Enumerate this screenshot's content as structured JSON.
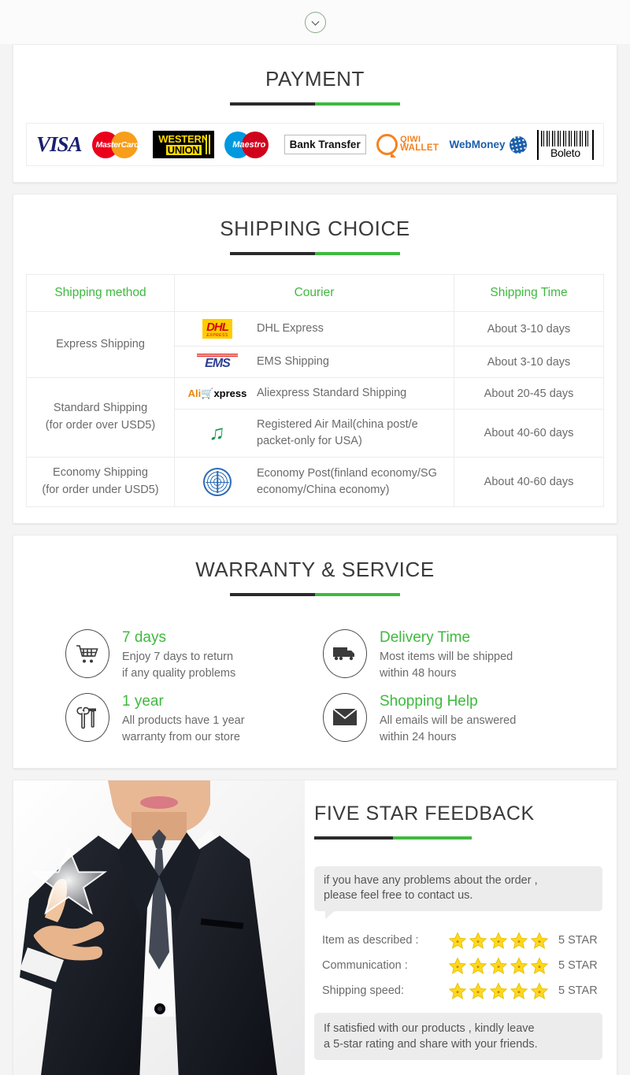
{
  "theme": {
    "green": "#3fb93f",
    "dark": "#2b2b2b",
    "text_gray": "#6b6b6b",
    "bg": "#f4f4f5"
  },
  "top": {
    "scroll_icon": "chevron-down-icon"
  },
  "payment": {
    "title": "PAYMENT",
    "methods": [
      {
        "name": "visa",
        "label": "VISA"
      },
      {
        "name": "mastercard",
        "label": "MasterCard"
      },
      {
        "name": "western-union",
        "label_line1": "WESTERN",
        "label_line2": "UNION"
      },
      {
        "name": "maestro",
        "label": "Maestro"
      },
      {
        "name": "bank-transfer",
        "label": "Bank Transfer"
      },
      {
        "name": "qiwi-wallet",
        "label_line1": "QIWI",
        "label_line2": "WALLET"
      },
      {
        "name": "webmoney",
        "label": "WebMoney"
      },
      {
        "name": "boleto",
        "label": "Boleto"
      }
    ]
  },
  "shipping": {
    "title": "SHIPPING CHOICE",
    "headers": [
      "Shipping method",
      "Courier",
      "Shipping Time"
    ],
    "groups": [
      {
        "method": "Express Shipping",
        "rows": [
          {
            "logo": "dhl-logo",
            "courier": "DHL Express",
            "time": "About 3-10 days"
          },
          {
            "logo": "ems-logo",
            "courier": "EMS Shipping",
            "time": "About 3-10 days"
          }
        ]
      },
      {
        "method": "Standard Shipping\n(for order over USD5)",
        "method_line1": "Standard Shipping",
        "method_line2": "(for order over USD5)",
        "rows": [
          {
            "logo": "aliexpress-logo",
            "courier": "Aliexpress Standard Shipping",
            "time": "About 20-45 days"
          },
          {
            "logo": "china-post-logo",
            "courier": "Registered Air Mail(china post/e packet-only for USA)",
            "time": "About 40-60 days"
          }
        ]
      },
      {
        "method_line1": "Economy Shipping",
        "method_line2": "(for order under USD5)",
        "rows": [
          {
            "logo": "un-logo",
            "courier": "Economy Post(finland economy/SG economy/China economy)",
            "time": "About 40-60 days"
          }
        ]
      }
    ]
  },
  "warranty": {
    "title": "WARRANTY & SERVICE",
    "items": [
      {
        "icon": "shopping-cart-icon",
        "heading": "7 days",
        "line1": "Enjoy 7 days to return",
        "line2": "if any quality problems"
      },
      {
        "icon": "truck-icon",
        "heading": "Delivery Time",
        "line1": "Most items will be shipped",
        "line2": "within 48 hours"
      },
      {
        "icon": "tools-icon",
        "heading": "1 year",
        "line1": "All products have 1 year",
        "line2": "warranty from our store"
      },
      {
        "icon": "envelope-icon",
        "heading": "Shopping Help",
        "line1": "All emails will be answered",
        "line2": "within 24 hours"
      }
    ]
  },
  "feedback": {
    "title": "FIVE STAR FEEDBACK",
    "photo_alt": "businessman-pointing-at-star",
    "bubble_line1": "if you have any problems about the order ,",
    "bubble_line2": "please feel free to contact us.",
    "ratings": [
      {
        "label": "Item as described :",
        "stars": 5,
        "value": "5 STAR"
      },
      {
        "label": "Communication :",
        "stars": 5,
        "value": "5 STAR"
      },
      {
        "label": "Shipping speed:",
        "stars": 5,
        "value": "5 STAR"
      }
    ],
    "footer_line1": "If satisfied with our products , kindly leave",
    "footer_line2": "a 5-star rating and share with your friends."
  }
}
